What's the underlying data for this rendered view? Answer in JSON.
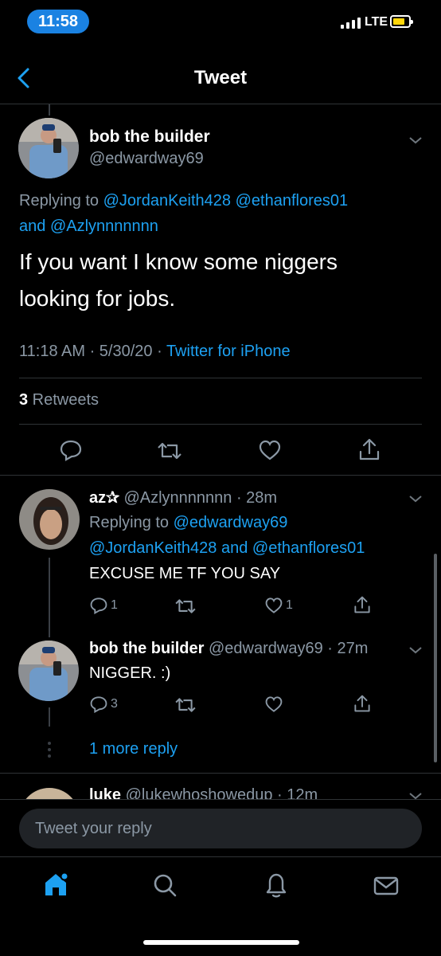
{
  "status_bar": {
    "time": "11:58",
    "network": "LTE"
  },
  "header": {
    "title": "Tweet"
  },
  "main_tweet": {
    "name": "bob the builder",
    "handle": "@edwardway69",
    "replying_prefix": "Replying to ",
    "replying_handles": [
      "@JordanKeith428",
      "@ethanflores01"
    ],
    "replying_and": "and ",
    "replying_last": "@Azlynnnnnnn",
    "text_line1": "If you want I know some niggers",
    "text_line2": "looking for jobs.",
    "timestamp": "11:18 AM · 5/30/20 · ",
    "source": "Twitter for iPhone",
    "retweet_count": "3",
    "retweet_label": " Retweets"
  },
  "replies": [
    {
      "name": "az✰",
      "handle_time": " @Azlynnnnnnn · 28m",
      "replying_prefix": "Replying to ",
      "replying_line1_handle": "@edwardway69",
      "replying_line2_a": "@JordanKeith428",
      "replying_line2_and": " and ",
      "replying_line2_b": "@ethanflores01",
      "text": "EXCUSE ME TF YOU SAY",
      "reply_count": "1",
      "like_count": "1"
    },
    {
      "name": "bob the builder",
      "handle_time": " @edwardway69 · 27m",
      "text": "NIGGER. :)",
      "reply_count": "3"
    },
    {
      "name": "luke",
      "handle_time": " @lukewhoshowedup · 12m"
    }
  ],
  "more_replies": "1 more reply",
  "reply_box": {
    "placeholder": "Tweet your reply"
  },
  "colors": {
    "accent": "#1da1f2",
    "secondary_text": "#8b98a5",
    "divider": "#2f3336",
    "background": "#000000"
  },
  "tab_bar": {
    "icons": [
      "home-icon",
      "search-icon",
      "notifications-icon",
      "messages-icon"
    ]
  }
}
